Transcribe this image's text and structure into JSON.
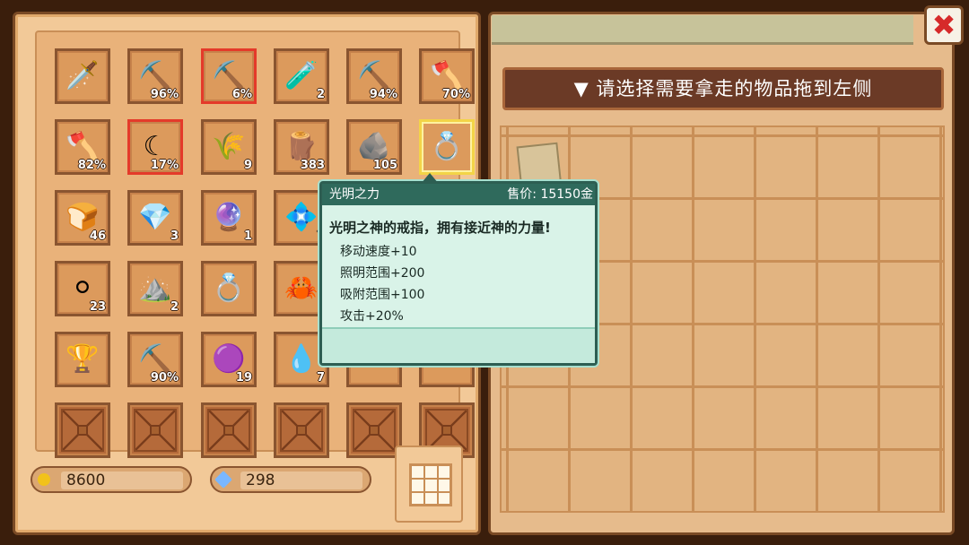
{
  "inventory": {
    "slots": [
      {
        "icon": "🗡️",
        "count": "",
        "state": ""
      },
      {
        "icon": "⛏️",
        "count": "96%",
        "state": ""
      },
      {
        "icon": "⛏️",
        "count": "6%",
        "state": "sel"
      },
      {
        "icon": "🧪",
        "count": "2",
        "state": ""
      },
      {
        "icon": "⛏️",
        "count": "94%",
        "state": ""
      },
      {
        "icon": "🪓",
        "count": "70%",
        "state": ""
      },
      {
        "icon": "🪓",
        "count": "82%",
        "state": ""
      },
      {
        "icon": "☾",
        "count": "17%",
        "state": "sel"
      },
      {
        "icon": "🌾",
        "count": "9",
        "state": ""
      },
      {
        "icon": "🪵",
        "count": "383",
        "state": ""
      },
      {
        "icon": "🪨",
        "count": "105",
        "state": ""
      },
      {
        "icon": "💍",
        "count": "",
        "state": "gold"
      },
      {
        "icon": "🍞",
        "count": "46",
        "state": ""
      },
      {
        "icon": "💎",
        "count": "3",
        "state": ""
      },
      {
        "icon": "🔮",
        "count": "1",
        "state": ""
      },
      {
        "icon": "💠",
        "count": "7",
        "state": ""
      },
      {
        "icon": "",
        "count": "",
        "state": ""
      },
      {
        "icon": "",
        "count": "",
        "state": ""
      },
      {
        "icon": "⚪",
        "count": "23",
        "state": ""
      },
      {
        "icon": "⛰️",
        "count": "2",
        "state": ""
      },
      {
        "icon": "💍",
        "count": "",
        "state": ""
      },
      {
        "icon": "🦀",
        "count": "",
        "state": ""
      },
      {
        "icon": "",
        "count": "",
        "state": ""
      },
      {
        "icon": "",
        "count": "",
        "state": ""
      },
      {
        "icon": "🏆",
        "count": "",
        "state": ""
      },
      {
        "icon": "⛏️",
        "count": "90%",
        "state": ""
      },
      {
        "icon": "🟣",
        "count": "19",
        "state": ""
      },
      {
        "icon": "💧",
        "count": "7",
        "state": ""
      },
      {
        "icon": "",
        "count": "",
        "state": ""
      },
      {
        "icon": "",
        "count": "",
        "state": ""
      },
      {
        "icon": "",
        "count": "",
        "state": "empty"
      },
      {
        "icon": "",
        "count": "",
        "state": "empty"
      },
      {
        "icon": "",
        "count": "",
        "state": "empty"
      },
      {
        "icon": "",
        "count": "",
        "state": "empty"
      },
      {
        "icon": "",
        "count": "",
        "state": "empty"
      },
      {
        "icon": "",
        "count": "",
        "state": "empty"
      }
    ]
  },
  "currency": {
    "gold": "8600",
    "gems": "298",
    "gold_color": "#f2c21a",
    "gem_color": "#7ab7ff"
  },
  "banner": "▼ 请选择需要拿走的物品拖到左侧",
  "tooltip": {
    "name": "光明之力",
    "price": "售价: 15150金",
    "description": "光明之神的戒指，拥有接近神的力量!",
    "stats": [
      "移动速度+10",
      "照明范围+200",
      "吸附范围+100",
      "攻击+20%"
    ]
  },
  "close_label": "✖"
}
